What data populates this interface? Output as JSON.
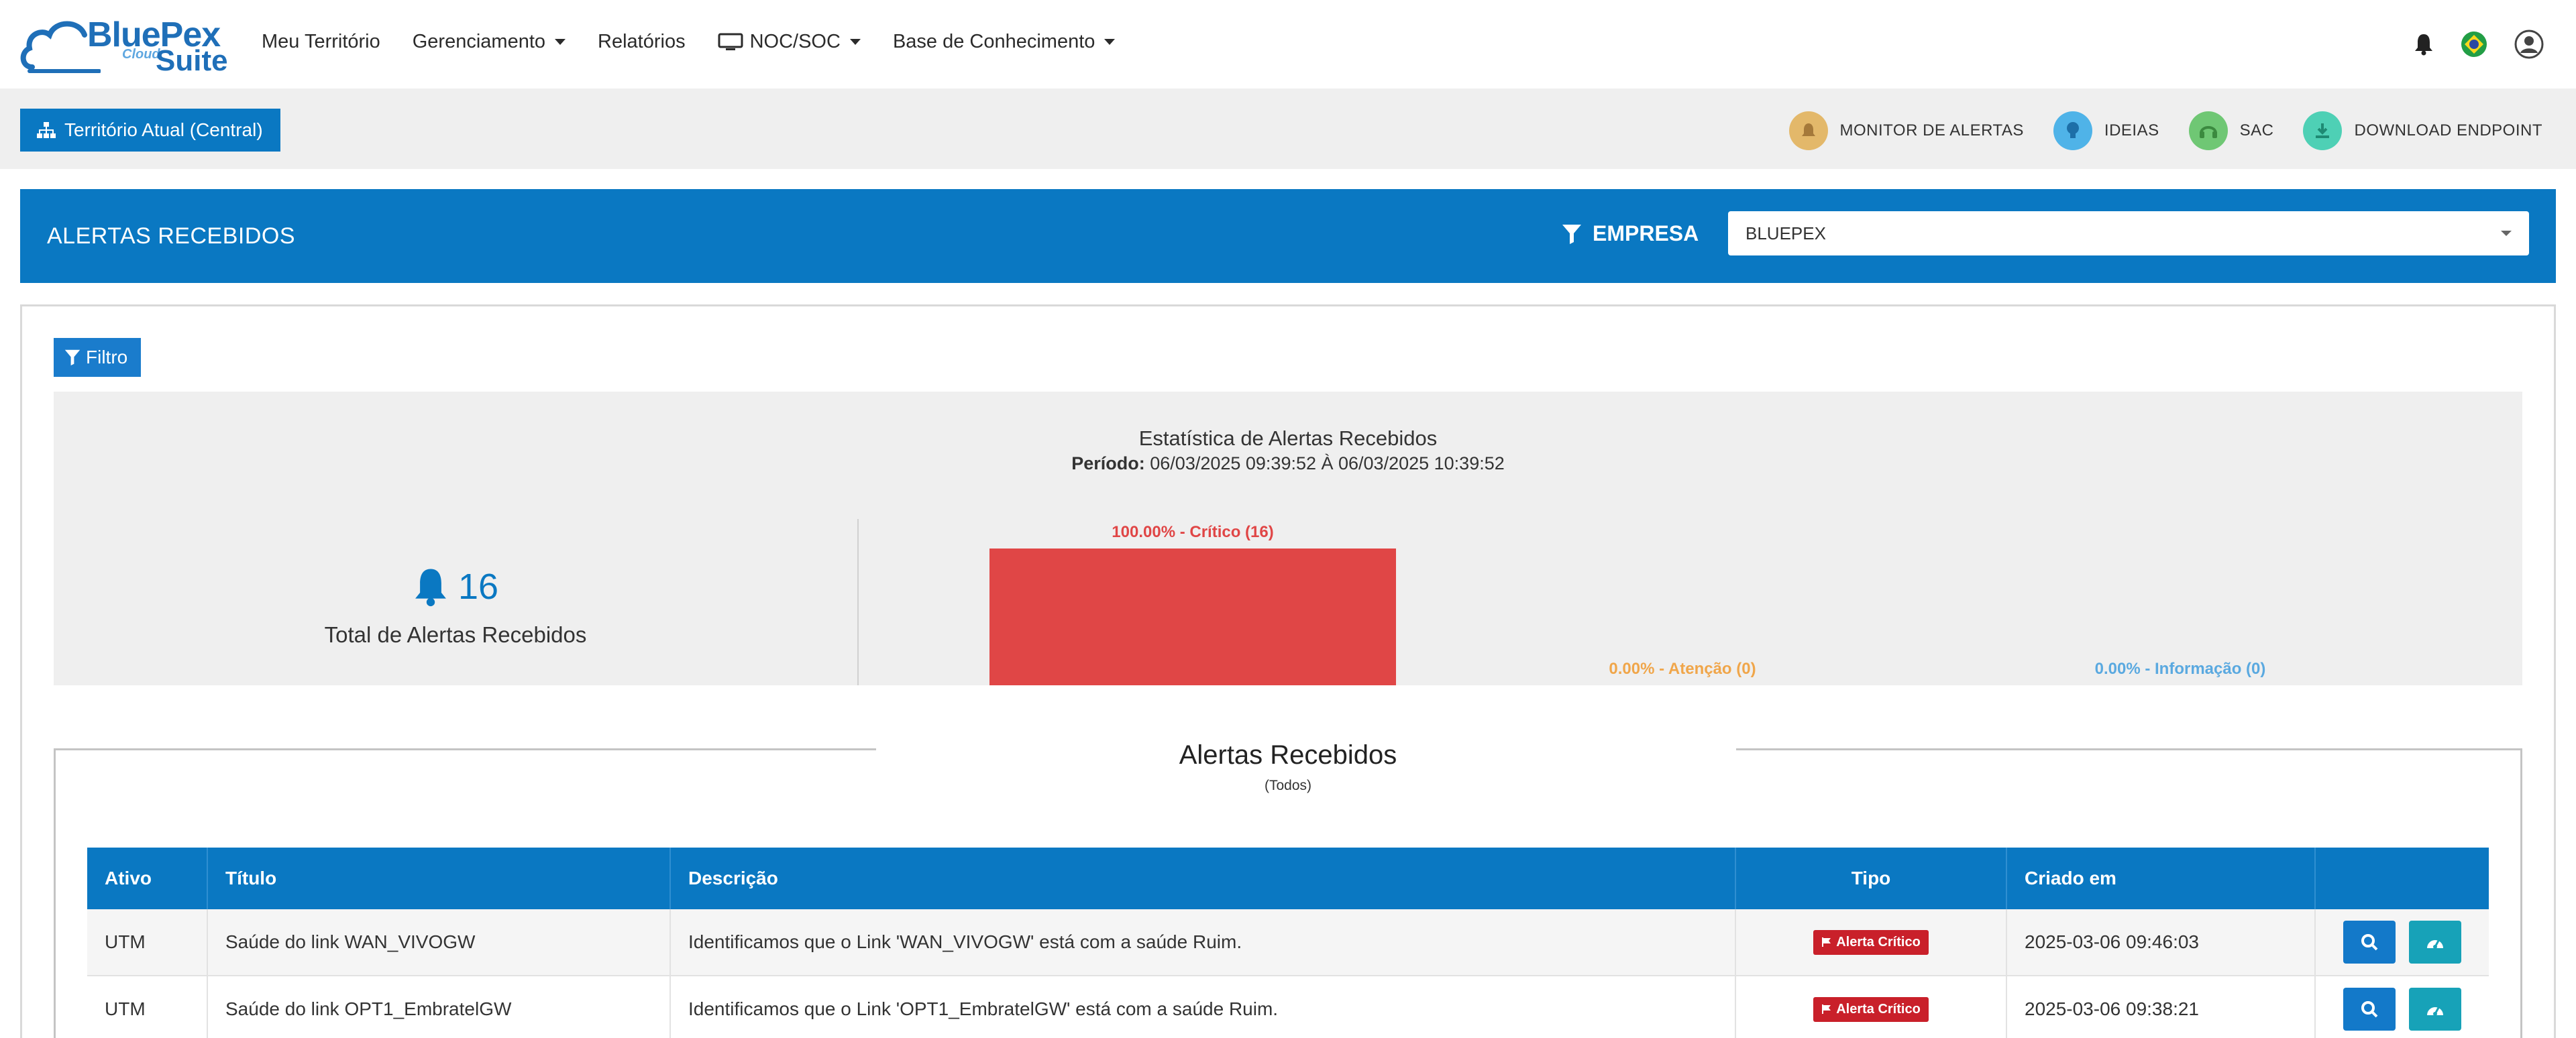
{
  "brand": {
    "name": "BluePex",
    "cloud": "Cloud",
    "suite": "Suite"
  },
  "nav": {
    "items": [
      {
        "label": "Meu Território",
        "dropdown": false
      },
      {
        "label": "Gerenciamento",
        "dropdown": true
      },
      {
        "label": "Relatórios",
        "dropdown": false
      },
      {
        "label": "NOC/SOC",
        "dropdown": true,
        "icon": "monitor-icon"
      },
      {
        "label": "Base de Conhecimento",
        "dropdown": true
      }
    ],
    "right_icons": [
      "bell-icon",
      "brazil-flag-icon",
      "user-avatar-icon"
    ]
  },
  "toolbar": {
    "territory_label": "Território Atual (Central)",
    "links": [
      {
        "label": "MONITOR DE ALERTAS",
        "icon": "alert-bell-icon",
        "color": "#e3b86a"
      },
      {
        "label": "IDEIAS",
        "icon": "lightbulb-icon",
        "color": "#4fb3e8"
      },
      {
        "label": "SAC",
        "icon": "headset-icon",
        "color": "#6fc774"
      },
      {
        "label": "DOWNLOAD ENDPOINT",
        "icon": "download-icon",
        "color": "#4ed0b5"
      }
    ]
  },
  "header": {
    "title": "ALERTAS RECEBIDOS",
    "empresa_label": "EMPRESA",
    "company_selected": "BLUEPEX"
  },
  "filter": {
    "label": "Filtro"
  },
  "stats": {
    "title": "Estatística de Alertas Recebidos",
    "period_label": "Período:",
    "period_value": "06/03/2025 09:39:52 À 06/03/2025 10:39:52",
    "total": "16",
    "total_label": "Total de Alertas Recebidos"
  },
  "chart_data": {
    "type": "bar",
    "categories": [
      "Crítico",
      "Atenção",
      "Informação"
    ],
    "values": [
      16,
      0,
      0
    ],
    "percentages": [
      100.0,
      0.0,
      0.0
    ],
    "labels": [
      "100.00% - Crítico (16)",
      "0.00% - Atenção (0)",
      "0.00% - Informação (0)"
    ],
    "colors": [
      "#e04646",
      "#f0a64a",
      "#5aa9e0"
    ],
    "ylim": [
      0,
      16
    ],
    "grid": false
  },
  "alerts": {
    "title": "Alertas Recebidos",
    "subtitle": "(Todos)",
    "columns": [
      "Ativo",
      "Título",
      "Descrição",
      "Tipo",
      "Criado em",
      ""
    ],
    "rows": [
      {
        "ativo": "UTM",
        "titulo": "Saúde do link WAN_VIVOGW",
        "descricao": "Identificamos que o Link 'WAN_VIVOGW' está com a saúde Ruim.",
        "tipo": "Alerta Crítico",
        "criado": "2025-03-06 09:46:03"
      },
      {
        "ativo": "UTM",
        "titulo": "Saúde do link OPT1_EmbratelGW",
        "descricao": "Identificamos que o Link 'OPT1_EmbratelGW' está com a saúde Ruim.",
        "tipo": "Alerta Crítico",
        "criado": "2025-03-06 09:38:21"
      }
    ]
  }
}
